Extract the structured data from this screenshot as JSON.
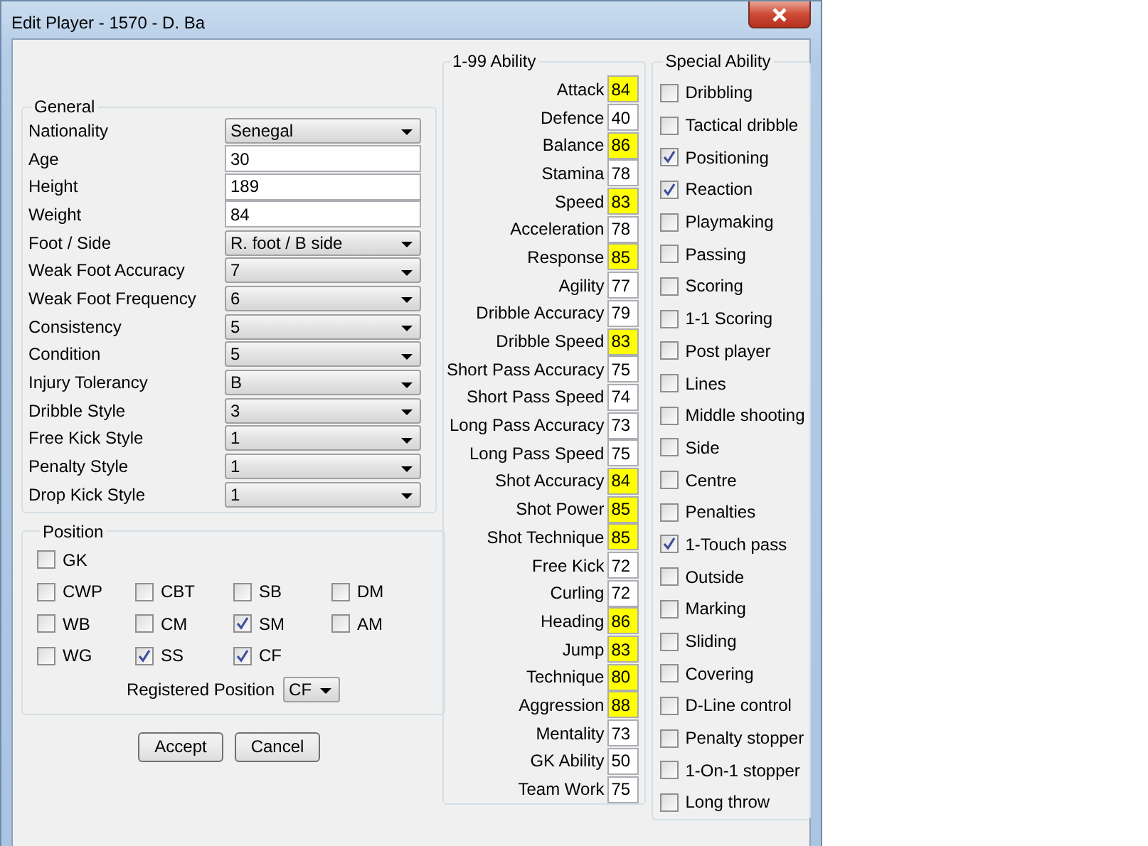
{
  "window": {
    "title": "Edit Player - 1570 - D. Ba"
  },
  "general": {
    "title": "General",
    "fields": [
      {
        "label": "Nationality",
        "kind": "dropdown",
        "value": "Senegal"
      },
      {
        "label": "Age",
        "kind": "text",
        "value": "30"
      },
      {
        "label": "Height",
        "kind": "text",
        "value": "189"
      },
      {
        "label": "Weight",
        "kind": "text",
        "value": "84"
      },
      {
        "label": "Foot / Side",
        "kind": "dropdown",
        "value": "R. foot / B side"
      },
      {
        "label": "Weak Foot Accuracy",
        "kind": "dropdown",
        "value": "7"
      },
      {
        "label": "Weak Foot Frequency",
        "kind": "dropdown",
        "value": "6"
      },
      {
        "label": "Consistency",
        "kind": "dropdown",
        "value": "5"
      },
      {
        "label": "Condition",
        "kind": "dropdown",
        "value": "5"
      },
      {
        "label": "Injury Tolerancy",
        "kind": "dropdown",
        "value": "B"
      },
      {
        "label": "Dribble Style",
        "kind": "dropdown",
        "value": "3"
      },
      {
        "label": "Free Kick Style",
        "kind": "dropdown",
        "value": "1"
      },
      {
        "label": "Penalty Style",
        "kind": "dropdown",
        "value": "1"
      },
      {
        "label": "Drop Kick Style",
        "kind": "dropdown",
        "value": "1"
      }
    ]
  },
  "position": {
    "title": "Position",
    "rows": [
      [
        {
          "label": "GK",
          "checked": false
        }
      ],
      [
        {
          "label": "CWP",
          "checked": false
        },
        {
          "label": "CBT",
          "checked": false
        },
        {
          "label": "SB",
          "checked": false
        },
        {
          "label": "DM",
          "checked": false
        }
      ],
      [
        {
          "label": "WB",
          "checked": false
        },
        {
          "label": "CM",
          "checked": false
        },
        {
          "label": "SM",
          "checked": true
        },
        {
          "label": "AM",
          "checked": false
        }
      ],
      [
        {
          "label": "WG",
          "checked": false
        },
        {
          "label": "SS",
          "checked": true
        },
        {
          "label": "CF",
          "checked": true
        }
      ]
    ],
    "registered_label": "Registered Position",
    "registered_value": "CF"
  },
  "buttons": [
    "Accept",
    "Cancel"
  ],
  "ability": {
    "title": "1-99 Ability",
    "rows": [
      {
        "label": "Attack",
        "value": "84",
        "highlighted": true
      },
      {
        "label": "Defence",
        "value": "40",
        "highlighted": false
      },
      {
        "label": "Balance",
        "value": "86",
        "highlighted": true
      },
      {
        "label": "Stamina",
        "value": "78",
        "highlighted": false
      },
      {
        "label": "Speed",
        "value": "83",
        "highlighted": true
      },
      {
        "label": "Acceleration",
        "value": "78",
        "highlighted": false
      },
      {
        "label": "Response",
        "value": "85",
        "highlighted": true
      },
      {
        "label": "Agility",
        "value": "77",
        "highlighted": false
      },
      {
        "label": "Dribble Accuracy",
        "value": "79",
        "highlighted": false
      },
      {
        "label": "Dribble Speed",
        "value": "83",
        "highlighted": true
      },
      {
        "label": "Short Pass Accuracy",
        "value": "75",
        "highlighted": false
      },
      {
        "label": "Short Pass Speed",
        "value": "74",
        "highlighted": false
      },
      {
        "label": "Long Pass Accuracy",
        "value": "73",
        "highlighted": false
      },
      {
        "label": "Long Pass Speed",
        "value": "75",
        "highlighted": false
      },
      {
        "label": "Shot Accuracy",
        "value": "84",
        "highlighted": true
      },
      {
        "label": "Shot Power",
        "value": "85",
        "highlighted": true
      },
      {
        "label": "Shot Technique",
        "value": "85",
        "highlighted": true
      },
      {
        "label": "Free Kick",
        "value": "72",
        "highlighted": false
      },
      {
        "label": "Curling",
        "value": "72",
        "highlighted": false
      },
      {
        "label": "Heading",
        "value": "86",
        "highlighted": true
      },
      {
        "label": "Jump",
        "value": "83",
        "highlighted": true
      },
      {
        "label": "Technique",
        "value": "80",
        "highlighted": true
      },
      {
        "label": "Aggression",
        "value": "88",
        "highlighted": true
      },
      {
        "label": "Mentality",
        "value": "73",
        "highlighted": false
      },
      {
        "label": "GK Ability",
        "value": "50",
        "highlighted": false
      },
      {
        "label": "Team Work",
        "value": "75",
        "highlighted": false
      }
    ]
  },
  "special": {
    "title": "Special Ability",
    "items": [
      {
        "label": "Dribbling",
        "checked": false
      },
      {
        "label": "Tactical dribble",
        "checked": false
      },
      {
        "label": "Positioning",
        "checked": true
      },
      {
        "label": "Reaction",
        "checked": true
      },
      {
        "label": "Playmaking",
        "checked": false
      },
      {
        "label": "Passing",
        "checked": false
      },
      {
        "label": "Scoring",
        "checked": false
      },
      {
        "label": "1-1 Scoring",
        "checked": false
      },
      {
        "label": "Post player",
        "checked": false
      },
      {
        "label": "Lines",
        "checked": false
      },
      {
        "label": "Middle shooting",
        "checked": false
      },
      {
        "label": "Side",
        "checked": false
      },
      {
        "label": "Centre",
        "checked": false
      },
      {
        "label": "Penalties",
        "checked": false
      },
      {
        "label": "1-Touch pass",
        "checked": true
      },
      {
        "label": "Outside",
        "checked": false
      },
      {
        "label": "Marking",
        "checked": false
      },
      {
        "label": "Sliding",
        "checked": false
      },
      {
        "label": "Covering",
        "checked": false
      },
      {
        "label": "D-Line control",
        "checked": false
      },
      {
        "label": "Penalty stopper",
        "checked": false
      },
      {
        "label": "1-On-1 stopper",
        "checked": false
      },
      {
        "label": "Long throw",
        "checked": false
      }
    ]
  }
}
